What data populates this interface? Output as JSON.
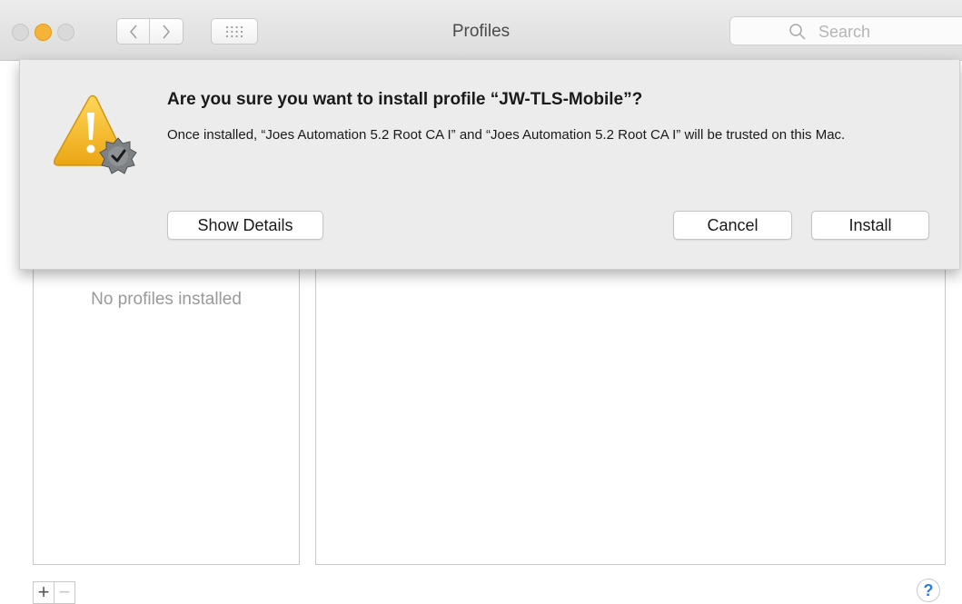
{
  "window": {
    "title": "Profiles"
  },
  "toolbar": {
    "back_icon": "chevron-left-icon",
    "forward_icon": "chevron-right-icon",
    "grid_icon": "grid-icon",
    "search": {
      "placeholder": "Search",
      "icon": "search-icon"
    }
  },
  "list": {
    "empty_text": "No profiles installed"
  },
  "list_controls": {
    "add_label": "+",
    "remove_label": "−",
    "help_label": "?"
  },
  "dialog": {
    "icon": "warning-icon",
    "title": "Are you sure you want to install profile “JW-TLS-Mobile”?",
    "message": "Once installed, “Joes Automation 5.2 Root CA I” and “Joes Automation 5.2 Root CA I” will be trusted on this Mac.",
    "buttons": {
      "show_details": "Show Details",
      "cancel": "Cancel",
      "install": "Install"
    }
  },
  "colors": {
    "minimize": "#f6b33a",
    "warning": "#f3b81d",
    "help": "#2a7cf0"
  }
}
